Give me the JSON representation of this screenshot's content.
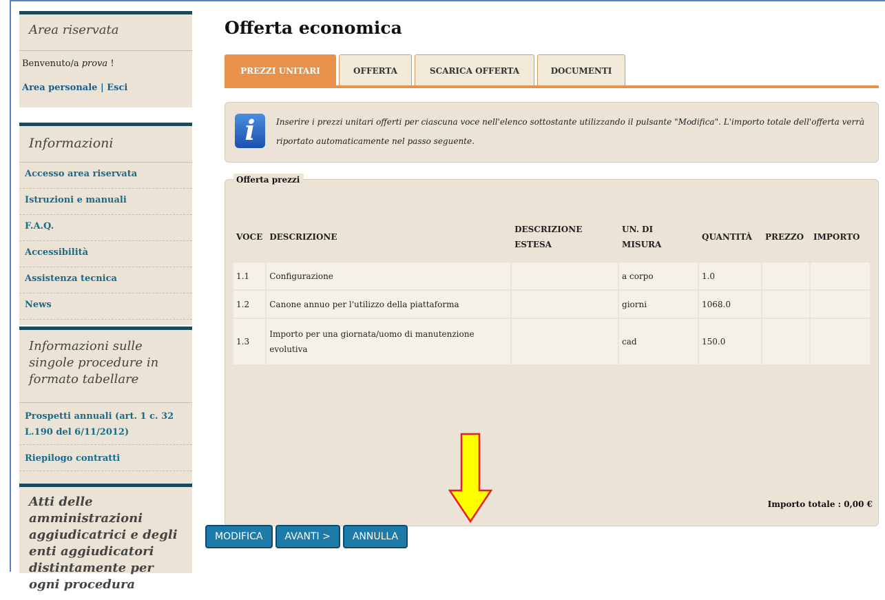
{
  "sidebar": {
    "area_riservata": {
      "title": "Area riservata",
      "welcome_prefix": "Benvenuto/a ",
      "user": "prova",
      "welcome_suffix": " !",
      "personal_link": "Area personale",
      "separator": "|",
      "exit_link": "Esci"
    },
    "informazioni": {
      "title": "Informazioni",
      "items": [
        "Accesso area riservata",
        "Istruzioni e manuali",
        "F.A.Q.",
        "Accessibilità",
        "Assistenza tecnica",
        "News"
      ]
    },
    "tabellare": {
      "title": "Informazioni sulle singole procedure in formato tabellare",
      "items": [
        "Prospetti annuali (art. 1 c. 32 L.190 del 6/11/2012)",
        "Riepilogo contratti"
      ]
    },
    "atti": {
      "title": "Atti delle amministrazioni aggiudicatrici e degli enti aggiudicatori distintamente per ogni procedura"
    }
  },
  "main": {
    "title": "Offerta economica",
    "tabs": [
      "PREZZI UNITARI",
      "OFFERTA",
      "SCARICA OFFERTA",
      "DOCUMENTI"
    ],
    "info_text": "Inserire i prezzi unitari offerti per ciascuna voce nell'elenco sottostante utilizzando il pulsante \"Modifica\". L'importo totale dell'offerta verrà riportato automaticamente nel passo seguente.",
    "info_icon": "info-icon",
    "fieldset_legend": "Offerta prezzi",
    "table": {
      "headers": [
        "VOCE",
        "DESCRIZIONE",
        "DESCRIZIONE ESTESA",
        "UN. DI MISURA",
        "QUANTITÀ",
        "PREZZO",
        "IMPORTO"
      ],
      "rows": [
        [
          "1.1",
          "Configurazione",
          "",
          "a corpo",
          "1.0",
          "",
          ""
        ],
        [
          "1.2",
          "Canone annuo per l'utilizzo della piattaforma",
          "",
          "giorni",
          "1068.0",
          "",
          ""
        ],
        [
          "1.3",
          "Importo per una giornata/uomo di manutenzione evolutiva",
          "",
          "cad",
          "150.0",
          "",
          ""
        ]
      ]
    },
    "total": "Importo totale : 0,00 €"
  },
  "buttons": {
    "modifica": "MODIFICA",
    "avanti": "AVANTI >",
    "annulla": "ANNULLA"
  },
  "colors": {
    "accent_tab": "#e8914a",
    "sidebar_bar": "#1c4a5a",
    "panel_bg": "#ebe4d6",
    "button": "#1e7aa8",
    "arrow_fill": "#ffff00",
    "arrow_stroke": "#e8201c"
  }
}
